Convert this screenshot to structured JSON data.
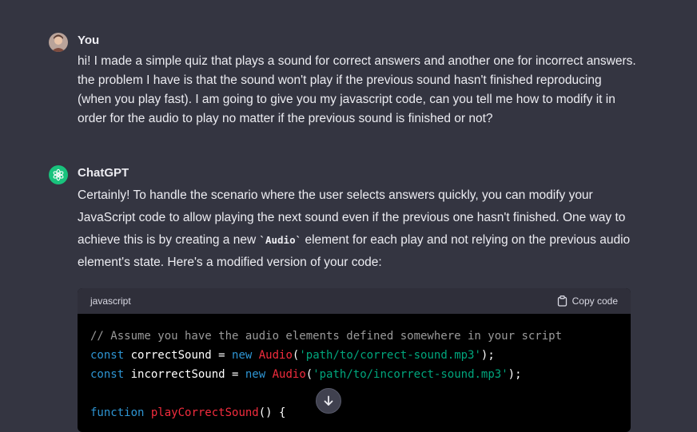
{
  "user_message": {
    "author": "You",
    "text": "hi! I made a simple quiz that plays a sound for correct answers and another one for incorrect answers. the problem I have is that the sound won't play if the previous sound hasn't finished reproducing (when you play fast).  I am going to give you my javascript code, can you tell me how to modify it in order for the audio to play no matter if the previous sound is finished or not?"
  },
  "assistant_message": {
    "author": "ChatGPT",
    "text_before": "Certainly! To handle the scenario where the user selects answers quickly, you can modify your JavaScript code to allow playing the next sound even if the previous one hasn't finished. One way to achieve this is by creating a new ",
    "inline_code": "`Audio`",
    "text_after": " element for each play and not relying on the previous audio element's state. Here's a modified version of your code:"
  },
  "code_block": {
    "language": "javascript",
    "copy_label": "Copy code",
    "lines": [
      {
        "tokens": [
          {
            "t": "comment",
            "v": "// Assume you have the audio elements defined somewhere in your script"
          }
        ]
      },
      {
        "tokens": [
          {
            "t": "kw",
            "v": "const"
          },
          {
            "t": "plain",
            "v": " correctSound = "
          },
          {
            "t": "kw",
            "v": "new"
          },
          {
            "t": "plain",
            "v": " "
          },
          {
            "t": "class",
            "v": "Audio"
          },
          {
            "t": "plain",
            "v": "("
          },
          {
            "t": "str",
            "v": "'path/to/correct-sound.mp3'"
          },
          {
            "t": "plain",
            "v": ");"
          }
        ]
      },
      {
        "tokens": [
          {
            "t": "kw",
            "v": "const"
          },
          {
            "t": "plain",
            "v": " incorrectSound = "
          },
          {
            "t": "kw",
            "v": "new"
          },
          {
            "t": "plain",
            "v": " "
          },
          {
            "t": "class",
            "v": "Audio"
          },
          {
            "t": "plain",
            "v": "("
          },
          {
            "t": "str",
            "v": "'path/to/incorrect-sound.mp3'"
          },
          {
            "t": "plain",
            "v": ");"
          }
        ]
      },
      {
        "tokens": []
      },
      {
        "tokens": [
          {
            "t": "kw",
            "v": "function"
          },
          {
            "t": "plain",
            "v": " "
          },
          {
            "t": "fn",
            "v": "playCorrectSound"
          },
          {
            "t": "plain",
            "v": "() {"
          }
        ]
      }
    ]
  },
  "icons": {
    "user_avatar": "user-avatar",
    "assistant_avatar": "openai-logo-icon",
    "copy": "clipboard-icon",
    "scroll": "arrow-down-icon"
  },
  "colors": {
    "background": "#343541",
    "assistant_avatar_bg": "#19c37d",
    "code_bg": "#000000",
    "code_header_bg": "#2f2f3a"
  }
}
